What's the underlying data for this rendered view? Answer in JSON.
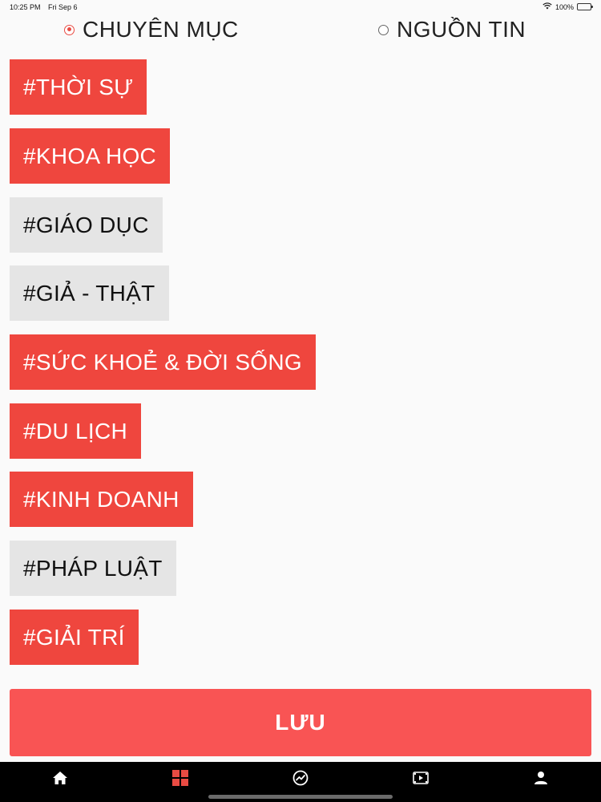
{
  "status_bar": {
    "time": "10:25 PM",
    "date": "Fri Sep 6",
    "battery": "100%",
    "battery_level": 1.0
  },
  "segments": {
    "chuyen_muc": {
      "label": "CHUYÊN MỤC",
      "selected": true
    },
    "nguon_tin": {
      "label": "NGUỒN TIN",
      "selected": false
    }
  },
  "tags": [
    {
      "label": "#THỜI SỰ",
      "active": true
    },
    {
      "label": "#KHOA HỌC",
      "active": true
    },
    {
      "label": "#GIÁO DỤC",
      "active": false
    },
    {
      "label": "#GIẢ - THẬT",
      "active": false
    },
    {
      "label": "#SỨC KHOẺ & ĐỜI SỐNG",
      "active": true
    },
    {
      "label": "#DU LỊCH",
      "active": true
    },
    {
      "label": "#KINH DOANH",
      "active": true
    },
    {
      "label": "#PHÁP LUẬT",
      "active": false
    },
    {
      "label": "#GIẢI TRÍ",
      "active": true
    }
  ],
  "save_button": {
    "label": "LƯU"
  },
  "tab_bar": {
    "items": [
      {
        "icon": "home-icon",
        "selected": false
      },
      {
        "icon": "grid-icon",
        "selected": true
      },
      {
        "icon": "trending-icon",
        "selected": false
      },
      {
        "icon": "video-icon",
        "selected": false
      },
      {
        "icon": "profile-icon",
        "selected": false
      }
    ]
  },
  "colors": {
    "accent": "#ef463e",
    "save_button": "#f95454",
    "inactive_tag": "#e5e5e5",
    "background": "#fafafa",
    "tab_bar": "#000000"
  }
}
